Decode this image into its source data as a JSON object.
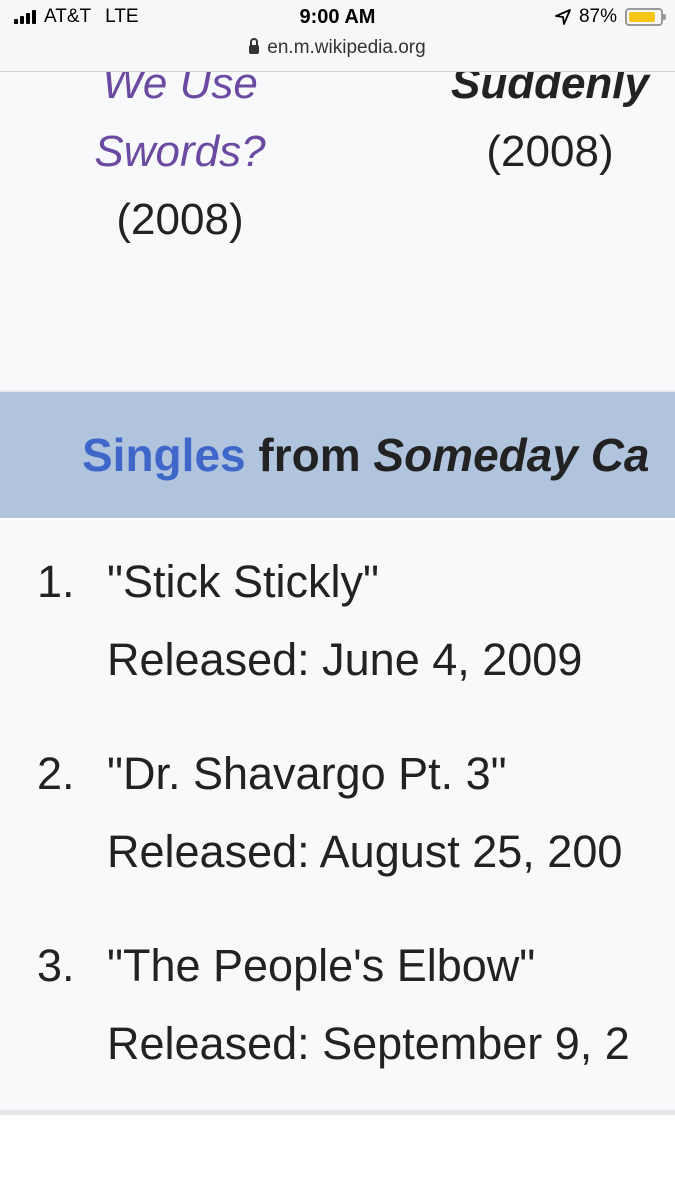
{
  "status_bar": {
    "carrier": "AT&T",
    "network": "LTE",
    "time": "9:00 AM",
    "battery_percent": "87%",
    "battery_level": 0.87,
    "url": "en.m.wikipedia.org"
  },
  "albums": [
    {
      "title_lines": [
        "We Use",
        "Swords?"
      ],
      "year": "(2008)",
      "linked": true
    },
    {
      "title_lines": [
        "Suddenly"
      ],
      "year": "(2008)",
      "linked": false
    }
  ],
  "singles_header": {
    "link_text": "Singles",
    "middle_text": " from ",
    "album_text": "Someday Ca"
  },
  "singles": [
    {
      "number": "1.",
      "title": "\"Stick Stickly\"",
      "released": "Released: June 4, 2009"
    },
    {
      "number": "2.",
      "title": "\"Dr. Shavargo Pt. 3\"",
      "released": "Released: August 25, 200"
    },
    {
      "number": "3.",
      "title": "\"The People's Elbow\"",
      "released": "Released: September 9, 2"
    }
  ],
  "colors": {
    "link_visited": "#6b4ba1",
    "link": "#3f66c9",
    "header_bg": "#b0c4de",
    "battery": "#f5c518"
  }
}
